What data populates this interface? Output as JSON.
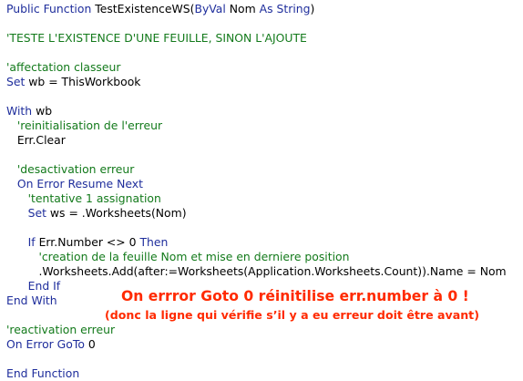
{
  "code_lines": [
    [
      {
        "t": "Public Function ",
        "c": "kw"
      },
      {
        "t": "TestExistenceWS(",
        "c": "nm"
      },
      {
        "t": "ByVal ",
        "c": "kw"
      },
      {
        "t": "Nom ",
        "c": "nm"
      },
      {
        "t": "As String",
        "c": "kw"
      },
      {
        "t": ")",
        "c": "nm"
      }
    ],
    [],
    [
      {
        "t": "'TESTE L'EXISTENCE D'UNE FEUILLE, SINON L'AJOUTE",
        "c": "cm"
      }
    ],
    [],
    [
      {
        "t": "'affectation classeur",
        "c": "cm"
      }
    ],
    [
      {
        "t": "Set ",
        "c": "kw"
      },
      {
        "t": "wb = ThisWorkbook",
        "c": "nm"
      }
    ],
    [],
    [
      {
        "t": "With ",
        "c": "kw"
      },
      {
        "t": "wb",
        "c": "nm"
      }
    ],
    [
      {
        "t": "   'reinitialisation de l'erreur",
        "c": "cm"
      }
    ],
    [
      {
        "t": "   Err.Clear",
        "c": "nm"
      }
    ],
    [],
    [
      {
        "t": "   'desactivation erreur",
        "c": "cm"
      }
    ],
    [
      {
        "t": "   On Error Resume Next",
        "c": "kw"
      }
    ],
    [
      {
        "t": "      'tentative 1 assignation",
        "c": "cm"
      }
    ],
    [
      {
        "t": "      Set ",
        "c": "kw"
      },
      {
        "t": "ws = .Worksheets(Nom)",
        "c": "nm"
      }
    ],
    [],
    [
      {
        "t": "      If ",
        "c": "kw"
      },
      {
        "t": "Err.Number <> 0 ",
        "c": "nm"
      },
      {
        "t": "Then",
        "c": "kw"
      }
    ],
    [
      {
        "t": "         'creation de la feuille Nom et mise en derniere position",
        "c": "cm"
      }
    ],
    [
      {
        "t": "         .Worksheets.Add(after:=Worksheets(Application.Worksheets.Count)).Name = Nom",
        "c": "nm"
      }
    ],
    [
      {
        "t": "      End If",
        "c": "kw"
      }
    ],
    [
      {
        "t": "End With",
        "c": "kw"
      }
    ],
    [],
    [
      {
        "t": "'reactivation erreur",
        "c": "cm"
      }
    ],
    [
      {
        "t": "On Error GoTo ",
        "c": "kw"
      },
      {
        "t": "0",
        "c": "nm"
      }
    ],
    [],
    [
      {
        "t": "End Function",
        "c": "kw"
      }
    ]
  ],
  "annotation": {
    "line1": "On errror Goto 0 réinitilise err.number à 0 !",
    "line2": "(donc la ligne qui vérifie s’il y a eu erreur doit être avant)"
  },
  "colors": {
    "keyword": "#1f2e9c",
    "comment": "#137a1b",
    "text": "#000000",
    "annotation": "#ff2a00"
  }
}
